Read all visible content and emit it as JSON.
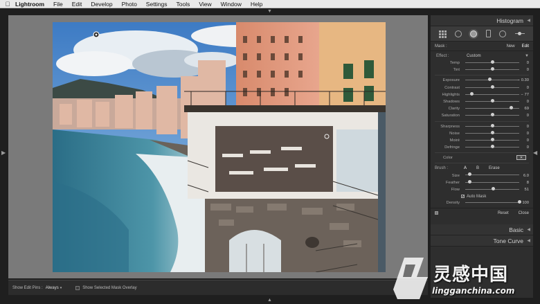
{
  "menubar": {
    "items": [
      "Lightroom",
      "File",
      "Edit",
      "Develop",
      "Photo",
      "Settings",
      "Tools",
      "View",
      "Window",
      "Help"
    ]
  },
  "toolbar": {
    "show_edit_pins_label": "Show Edit Pins :",
    "show_edit_pins_value": "Always",
    "mask_overlay_label": "Show Selected Mask Overlay",
    "mask_overlay_checked": false
  },
  "panel": {
    "histogram_label": "Histogram",
    "mask_label": "Mask :",
    "mask_new": "New",
    "mask_edit": "Edit",
    "effect_label": "Effect :",
    "effect_value": "Custom",
    "temp_tint": [
      {
        "label": "Temp",
        "value": "0",
        "pos": 0.5
      },
      {
        "label": "Tint",
        "value": "0",
        "pos": 0.5
      }
    ],
    "tone": [
      {
        "label": "Exposure",
        "value": "− 0.30",
        "pos": 0.45
      },
      {
        "label": "Contrast",
        "value": "0",
        "pos": 0.5
      },
      {
        "label": "Highlights",
        "value": "− 77",
        "pos": 0.12
      },
      {
        "label": "Shadows",
        "value": "0",
        "pos": 0.5
      },
      {
        "label": "Clarity",
        "value": "69",
        "pos": 0.85
      },
      {
        "label": "Saturation",
        "value": "0",
        "pos": 0.5
      }
    ],
    "detail": [
      {
        "label": "Sharpness",
        "value": "0",
        "pos": 0.5
      },
      {
        "label": "Noise",
        "value": "0",
        "pos": 0.5
      },
      {
        "label": "Moiré",
        "value": "0",
        "pos": 0.5
      },
      {
        "label": "Defringe",
        "value": "0",
        "pos": 0.5
      }
    ],
    "color_label": "Color",
    "brush_label": "Brush :",
    "brush_a": "A",
    "brush_b": "B",
    "brush_erase": "Erase",
    "brush": [
      {
        "label": "Size",
        "value": "6.0",
        "pos": 0.08
      },
      {
        "label": "Feather",
        "value": "8",
        "pos": 0.08
      },
      {
        "label": "Flow",
        "value": "51",
        "pos": 0.51
      }
    ],
    "auto_mask_label": "Auto Mask",
    "auto_mask_checked": true,
    "density": {
      "label": "Density",
      "value": "100",
      "pos": 1.0
    },
    "reset_label": "Reset",
    "close_label": "Close",
    "basic_label": "Basic",
    "tone_curve_label": "Tone Curve"
  },
  "watermark": {
    "cn": "灵感中国",
    "url": "lingganchina.com"
  },
  "colors": {
    "panel_bg": "#2e2e2e",
    "workspace_bg": "#7a7a7a",
    "menubar_bg": "#e9e9e9"
  }
}
